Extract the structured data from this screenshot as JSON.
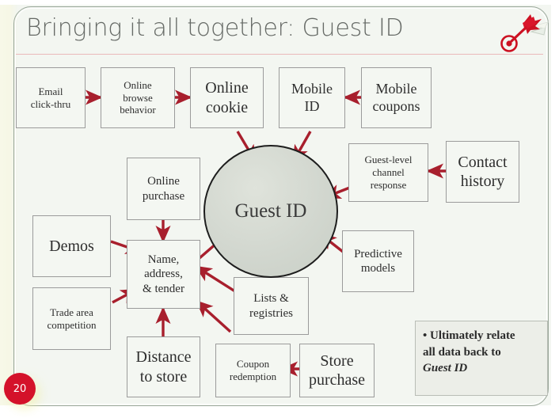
{
  "slide": {
    "title": "Bringing it all together: Guest ID",
    "page_number": "20",
    "logo_name": "dart-on-target-logo",
    "colors": {
      "background": "#f3f6f1",
      "title_text": "#666a66",
      "title_rule": "#eab9b9",
      "arrow": "#a81f2d",
      "badge": "#d4122a",
      "box_border": "#9b9b9b",
      "hub_border": "#1d1d1d",
      "hub_fill": "#d2d7cf"
    }
  },
  "hub": {
    "label": "Guest ID"
  },
  "nodes": [
    {
      "id": "email-click-thru",
      "label": "Email\nclick-thru"
    },
    {
      "id": "online-browse-behavior",
      "label": "Online\nbrowse\nbehavior"
    },
    {
      "id": "online-cookie",
      "label": "Online\ncookie"
    },
    {
      "id": "mobile-id",
      "label": "Mobile\nID"
    },
    {
      "id": "mobile-coupons",
      "label": "Mobile\ncoupons"
    },
    {
      "id": "guest-level-channel-response",
      "label": "Guest-level\nchannel\nresponse"
    },
    {
      "id": "contact-history",
      "label": "Contact\nhistory"
    },
    {
      "id": "online-purchase",
      "label": "Online\npurchase"
    },
    {
      "id": "demos",
      "label": "Demos"
    },
    {
      "id": "name-address-tender",
      "label": "Name,\naddress,\n& tender"
    },
    {
      "id": "trade-area-competition",
      "label": "Trade area\ncompetition"
    },
    {
      "id": "distance-to-store",
      "label": "Distance\nto store"
    },
    {
      "id": "lists-registries",
      "label": "Lists &\nregistries"
    },
    {
      "id": "coupon-redemption",
      "label": "Coupon\nredemption"
    },
    {
      "id": "store-purchase",
      "label": "Store\npurchase"
    },
    {
      "id": "predictive-models",
      "label": "Predictive\nmodels"
    }
  ],
  "callout": {
    "bullet": "• Ultimately relate",
    "line2": "all data back to",
    "line3": "Guest ID"
  },
  "connections": [
    {
      "from": "email-click-thru",
      "to": "online-browse-behavior"
    },
    {
      "from": "online-browse-behavior",
      "to": "online-cookie"
    },
    {
      "from": "mobile-coupons",
      "to": "mobile-id"
    },
    {
      "from": "contact-history",
      "to": "guest-level-channel-response"
    },
    {
      "from": "store-purchase",
      "to": "coupon-redemption"
    },
    {
      "from": "online-cookie",
      "to": "hub"
    },
    {
      "from": "mobile-id",
      "to": "hub"
    },
    {
      "from": "guest-level-channel-response",
      "to": "hub"
    },
    {
      "from": "predictive-models",
      "to": "hub"
    },
    {
      "from": "name-address-tender",
      "to": "hub"
    },
    {
      "from": "online-purchase",
      "to": "name-address-tender"
    },
    {
      "from": "demos",
      "to": "name-address-tender"
    },
    {
      "from": "trade-area-competition",
      "to": "name-address-tender"
    },
    {
      "from": "distance-to-store",
      "to": "name-address-tender"
    },
    {
      "from": "lists-registries",
      "to": "name-address-tender"
    },
    {
      "from": "coupon-redemption",
      "to": "name-address-tender"
    }
  ]
}
